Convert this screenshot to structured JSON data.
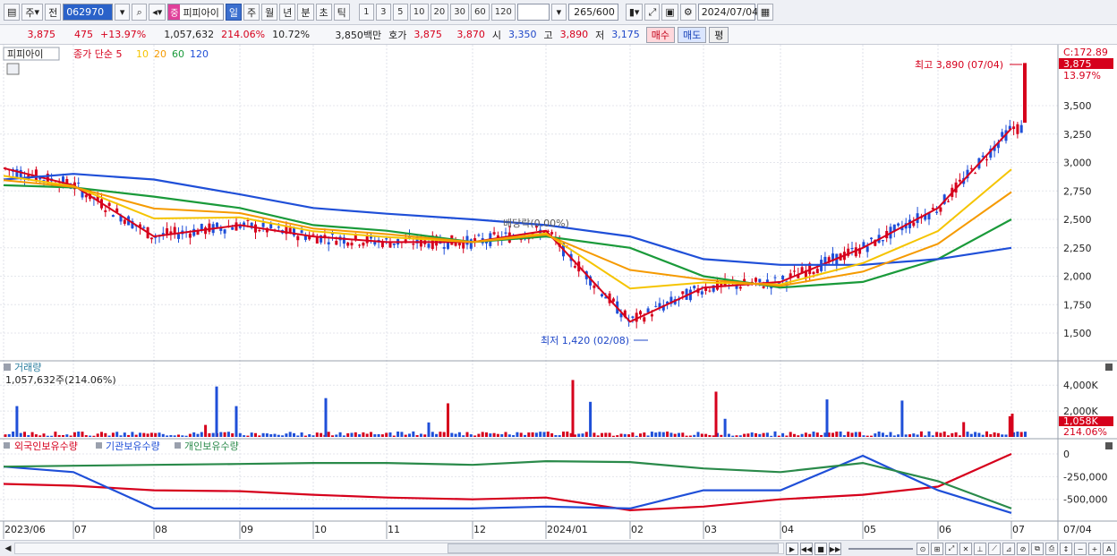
{
  "toolbar": {
    "market": "주",
    "prev_btn": "전",
    "code": "062970",
    "name_tag": "중",
    "name": "피피아이",
    "periods": [
      "일",
      "주",
      "월",
      "년",
      "분",
      "초",
      "틱"
    ],
    "active_period": "일",
    "intervals": [
      "1",
      "3",
      "5",
      "10",
      "20",
      "30",
      "60",
      "120"
    ],
    "count": "265",
    "count_total": "/600",
    "date": "2024/07/04"
  },
  "info": {
    "price": "3,875",
    "change": "475",
    "change_pct": "+13.97%",
    "volume": "1,057,632",
    "volume_pct": "214.06%",
    "turnover": "10.72%",
    "amount": "3,850백만",
    "quote_label": "호가",
    "ask": "3,875",
    "bid": "3,870",
    "open_label": "시",
    "open": "3,350",
    "high_label": "고",
    "high": "3,890",
    "low_label": "저",
    "low": "3,175",
    "buy_btn": "매수",
    "sell_btn": "매도",
    "flat_btn": "평"
  },
  "price_panel": {
    "legend_name": "피피아이",
    "legend_items": [
      {
        "label": "종가 단순 5",
        "color": "#d6001c"
      },
      {
        "label": "10",
        "color": "#f5c400"
      },
      {
        "label": "20",
        "color": "#f59a00"
      },
      {
        "label": "60",
        "color": "#1a9a3a"
      },
      {
        "label": "120",
        "color": "#1f4fd8"
      }
    ],
    "y_ticks": [
      "3,500",
      "3,250",
      "3,000",
      "2,750",
      "2,500",
      "2,250",
      "2,000",
      "1,750",
      "1,500"
    ],
    "top_label": "C:172.89",
    "current_price_tag": "3,875",
    "current_pct_tag": "13.97%",
    "high_annotation": "최고 3,890 (07/04)",
    "low_annotation": "최저 1,420 (02/08)",
    "dividend_annotation": "배당락(0.00%)"
  },
  "volume_panel": {
    "title": "거래량",
    "value": "1,057,632주(214.06%)",
    "y_ticks": [
      "4,000K",
      "2,000K"
    ],
    "current_tag": "1,058K",
    "pct_tag": "214.06%"
  },
  "holding_panel": {
    "legend": [
      {
        "label": "외국인보유수량",
        "color": "#d6001c"
      },
      {
        "label": "기관보유수량",
        "color": "#1f4fd8"
      },
      {
        "label": "개인보유수량",
        "color": "#2a8a4a"
      }
    ],
    "y_ticks": [
      "0",
      "-250,000",
      "-500,000"
    ]
  },
  "x_axis": [
    "2023/06",
    "07",
    "08",
    "09",
    "10",
    "11",
    "12",
    "2024/01",
    "02",
    "03",
    "04",
    "05",
    "06",
    "07"
  ],
  "x_axis_right": "07/04",
  "chart_data": {
    "type": "line",
    "title": "",
    "x": [
      "2023/06",
      "07",
      "08",
      "09",
      "10",
      "11",
      "12",
      "2024/01",
      "02",
      "03",
      "04",
      "05",
      "06",
      "07"
    ],
    "ylim": [
      1420,
      3890
    ],
    "series": [
      {
        "name": "종가 단순 5",
        "values": [
          2950,
          2800,
          2350,
          2450,
          2350,
          2300,
          2300,
          2400,
          1600,
          1900,
          1950,
          2250,
          2600,
          3300
        ]
      },
      {
        "name": "60",
        "values": [
          2800,
          2780,
          2700,
          2600,
          2450,
          2400,
          2300,
          2350,
          2250,
          2000,
          1900,
          1950,
          2150,
          2500
        ]
      },
      {
        "name": "120",
        "values": [
          2850,
          2900,
          2850,
          2720,
          2600,
          2550,
          2500,
          2450,
          2350,
          2150,
          2100,
          2100,
          2150,
          2250
        ]
      }
    ]
  }
}
